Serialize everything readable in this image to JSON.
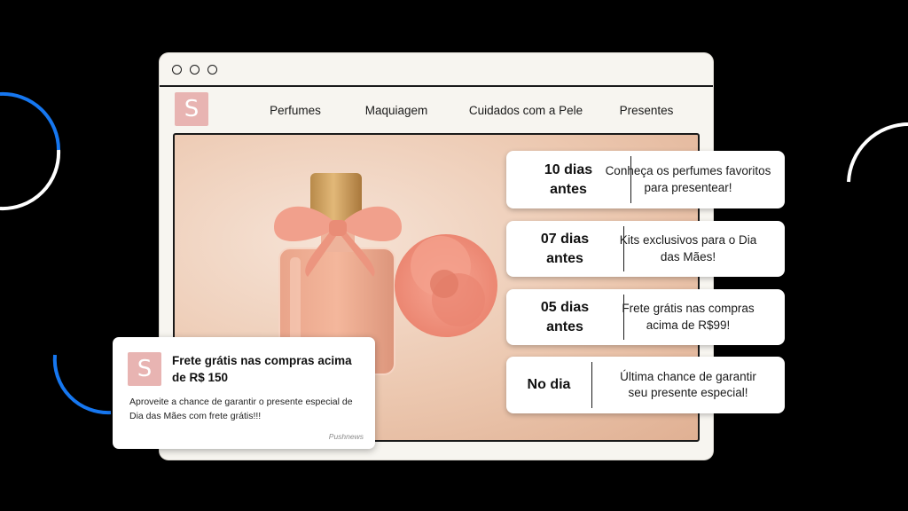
{
  "logo_letter": "S",
  "nav": [
    "Perfumes",
    "Maquiagem",
    "Cuidados com a Pele",
    "Presentes"
  ],
  "timeline": [
    {
      "when": "10 dias antes",
      "text": "Conheça os perfumes favoritos para presentear!"
    },
    {
      "when": "07 dias antes",
      "text": "Kits exclusivos para o Dia das Mães!"
    },
    {
      "when": "05 dias antes",
      "text": "Frete grátis nas compras acima de R$99!"
    },
    {
      "when": "No dia",
      "text": "Última chance de garantir seu presente especial!"
    }
  ],
  "notification": {
    "logo_letter": "S",
    "title": "Frete grátis nas compras acima de R$ 150",
    "body": "Aproveite a chance de garantir o presente especial de Dia das Mães com frete grátis!!!",
    "brand": "Pushnews"
  },
  "colors": {
    "accent_blue": "#1677f0",
    "logo_pink": "#e8b4b2",
    "background": "#000000"
  }
}
